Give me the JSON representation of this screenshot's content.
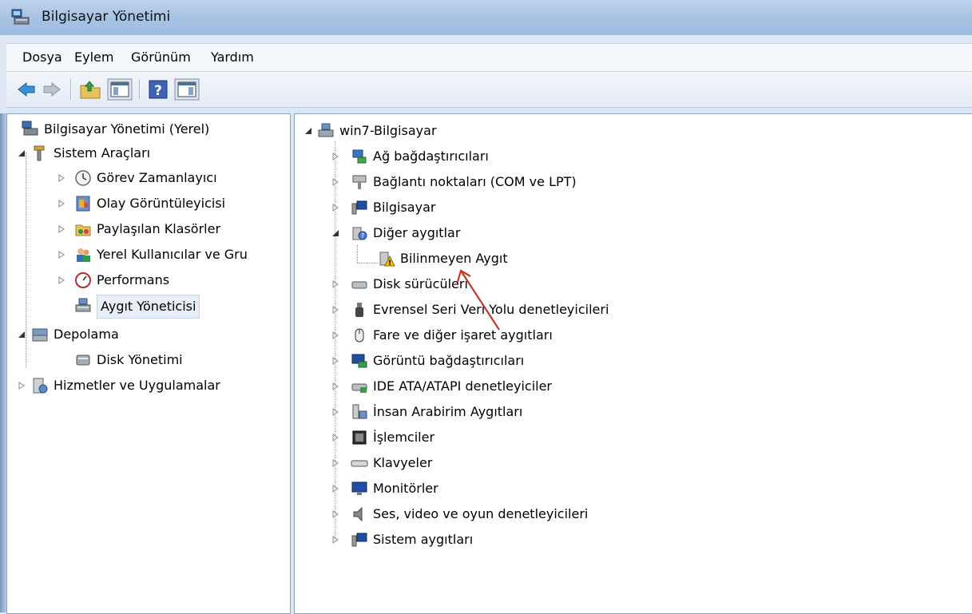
{
  "window": {
    "title": "Bilgisayar Yönetimi"
  },
  "menu": {
    "items": [
      "Dosya",
      "Eylem",
      "Görünüm",
      "Yardım"
    ]
  },
  "toolbar": {
    "buttons": [
      "back-icon",
      "forward-icon",
      "up-folder-icon",
      "show-hide-console-tree-icon",
      "help-icon",
      "show-hide-action-pane-icon"
    ]
  },
  "left_tree": {
    "root": "Bilgisayar Yönetimi (Yerel)",
    "system_tools": "Sistem Araçları",
    "task_scheduler": "Görev Zamanlayıcı",
    "event_viewer": "Olay Görüntüleyicisi",
    "shared_folders": "Paylaşılan Klasörler",
    "local_users": "Yerel Kullanıcılar ve Gru",
    "performance": "Performans",
    "device_manager": "Aygıt Yöneticisi",
    "storage": "Depolama",
    "disk_management": "Disk Yönetimi",
    "services_apps": "Hizmetler ve Uygulamalar"
  },
  "device_tree": {
    "root": "win7-Bilgisayar",
    "categories": [
      "Ağ bağdaştırıcıları",
      "Bağlantı noktaları (COM ve LPT)",
      "Bilgisayar",
      "Diğer aygıtlar",
      "Disk sürücüleri",
      "Evrensel Seri Veri Yolu denetleyicileri",
      "Fare ve diğer işaret aygıtları",
      "Görüntü bağdaştırıcıları",
      "IDE ATA/ATAPI denetleyiciler",
      "İnsan Arabirim Aygıtları",
      "İşlemciler",
      "Klavyeler",
      "Monitörler",
      "Ses, video ve oyun denetleyicileri",
      "Sistem aygıtları"
    ],
    "unknown_device": "Bilinmeyen Aygıt"
  },
  "colors": {
    "titlebar": "#a9c4e4",
    "selection": "#e8eef7",
    "arrow": "#c0392b"
  }
}
